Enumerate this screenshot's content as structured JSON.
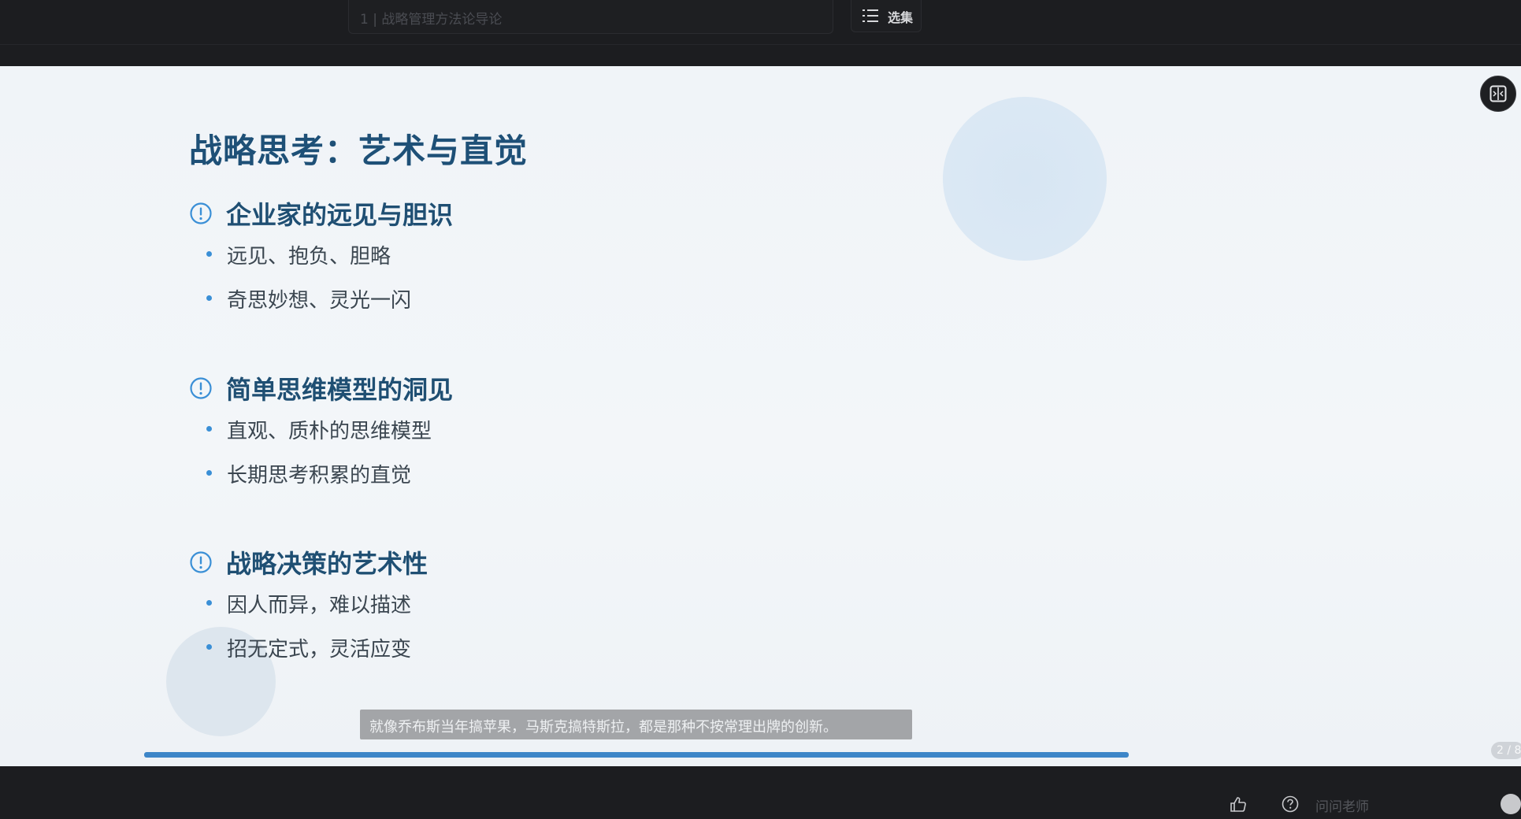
{
  "header": {
    "lesson_title": "1 | 战略管理方法论导论",
    "playlist_label": "选集",
    "playlist_icon": "list-icon"
  },
  "slide": {
    "title": "战略思考：艺术与直觉",
    "sections": [
      {
        "icon": "info-circle-icon",
        "title": "企业家的远见与胆识",
        "bullets": [
          "远见、抱负、胆略",
          "奇思妙想、灵光一闪"
        ]
      },
      {
        "icon": "info-circle-icon",
        "title": "简单思维模型的洞见",
        "bullets": [
          "直观、质朴的思维模型",
          "长期思考积累的直觉"
        ]
      },
      {
        "icon": "info-circle-icon",
        "title": "战略决策的艺术性",
        "bullets": [
          "因人而异，难以描述",
          "招无定式，灵活应变"
        ]
      }
    ],
    "subtitle": "就像乔布斯当年搞苹果，马斯克搞特斯拉，都是那种不按常理出牌的创新。",
    "page_indicator": "2 / 8",
    "accent_color": "#1e5077",
    "bullet_color": "#3a8fd6"
  },
  "controls": {
    "fullscreen_icon": "split-view-icon",
    "like_icon": "thumbs-up-icon",
    "help_icon": "question-circle-icon",
    "ask_placeholder": "问问老师"
  }
}
